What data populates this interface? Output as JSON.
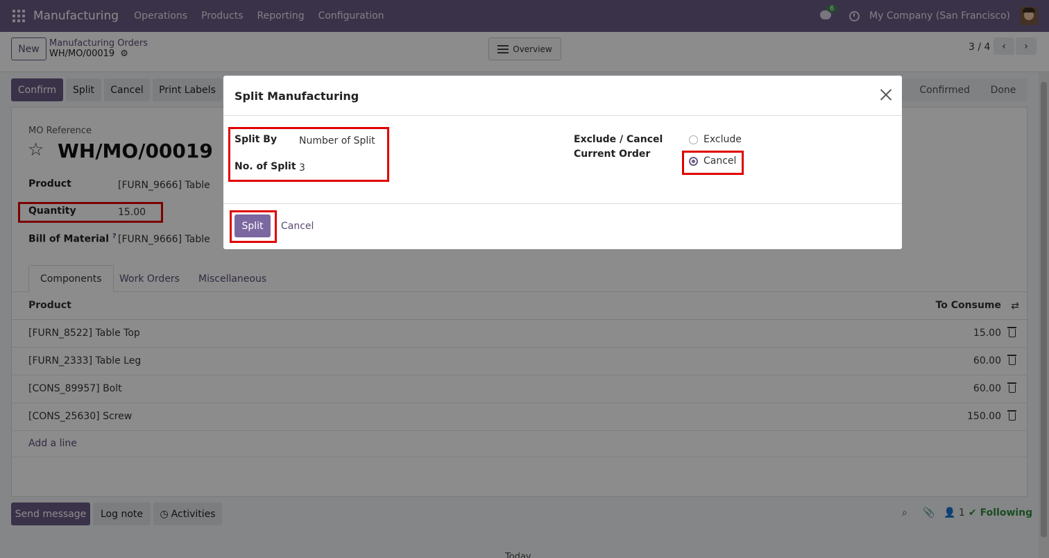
{
  "navbar": {
    "brand": "Manufacturing",
    "menu": [
      "Operations",
      "Products",
      "Reporting",
      "Configuration"
    ],
    "chat_count": "6",
    "company": "My Company (San Francisco)"
  },
  "control": {
    "new_label": "New",
    "breadcrumb_parent": "Manufacturing Orders",
    "breadcrumb_current": "WH/MO/00019",
    "overview_label": "Overview",
    "pager": "3 / 4"
  },
  "actions": {
    "confirm": "Confirm",
    "split": "Split",
    "cancel": "Cancel",
    "print_labels": "Print Labels"
  },
  "status": [
    "Confirmed",
    "Done"
  ],
  "form": {
    "mo_reference_label": "MO Reference",
    "mo_reference": "WH/MO/00019",
    "product_label": "Product",
    "product_value": "[FURN_9666] Table",
    "quantity_label": "Quantity",
    "quantity_value": "15.00",
    "bom_label": "Bill of Material",
    "bom_help": "?",
    "bom_value": "[FURN_9666] Table"
  },
  "tabs": [
    "Components",
    "Work Orders",
    "Miscellaneous"
  ],
  "table": {
    "col_product": "Product",
    "col_to_consume": "To Consume",
    "rows": [
      {
        "product": "[FURN_8522] Table Top",
        "qty": "15.00"
      },
      {
        "product": "[FURN_2333] Table Leg",
        "qty": "60.00"
      },
      {
        "product": "[CONS_89957] Bolt",
        "qty": "60.00"
      },
      {
        "product": "[CONS_25630] Screw",
        "qty": "150.00"
      }
    ],
    "add_line": "Add a line"
  },
  "chatter": {
    "send_message": "Send message",
    "log_note": "Log note",
    "activities": "Activities",
    "followers": "1",
    "following": "Following",
    "today": "Today"
  },
  "dialog": {
    "title": "Split Manufacturing",
    "split_by_label": "Split By",
    "split_by_value": "Number of Split",
    "no_of_split_label": "No. of Split",
    "no_of_split_value": "3",
    "exclude_cancel_label_1": "Exclude / Cancel",
    "exclude_cancel_label_2": "Current Order",
    "option_exclude": "Exclude",
    "option_cancel": "Cancel",
    "split_button": "Split",
    "cancel_button": "Cancel"
  },
  "colors": {
    "brand": "#6b5b85",
    "highlight": "#e00000",
    "following": "#2e8b3c"
  }
}
